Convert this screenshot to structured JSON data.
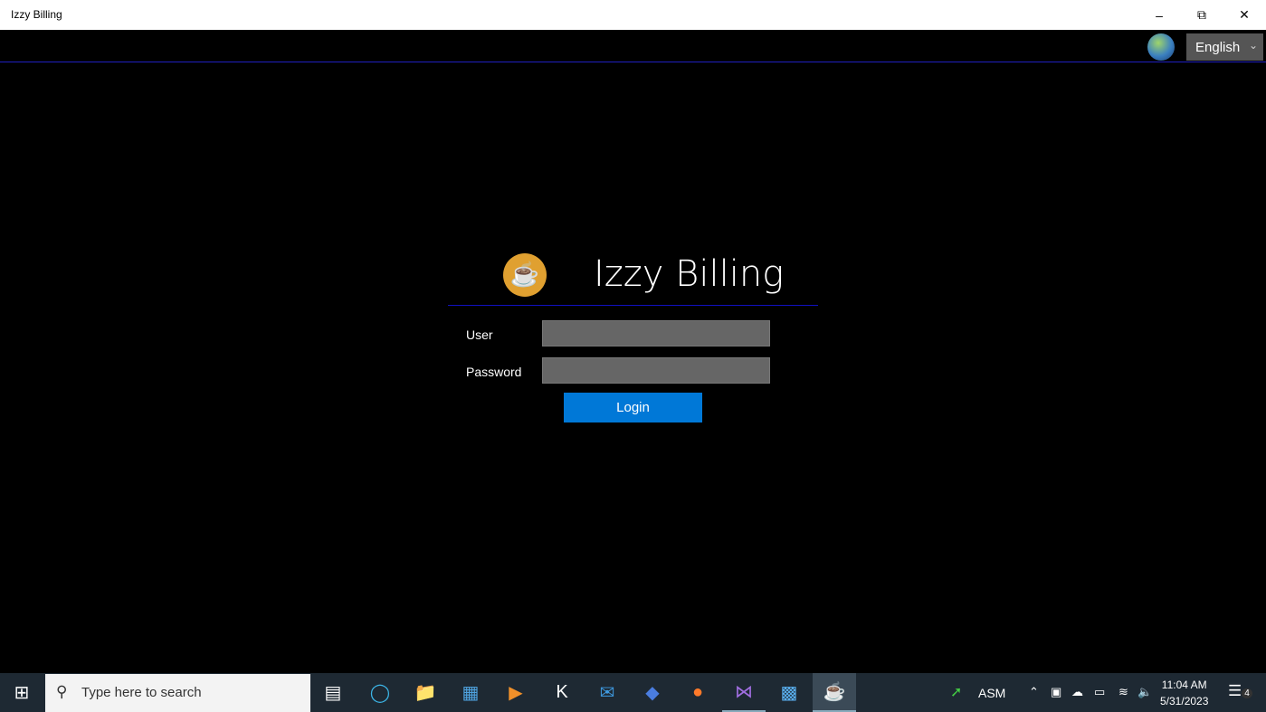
{
  "window": {
    "title": "Izzy Billing"
  },
  "topbar": {
    "language": "English"
  },
  "login": {
    "app_title": "Izzy Billing",
    "user_label": "User",
    "password_label": "Password",
    "user_value": "",
    "password_value": "",
    "login_button": "Login"
  },
  "taskbar": {
    "search_placeholder": "Type here to search",
    "tray_app": "ASM",
    "time": "11:04 AM",
    "date": "5/31/2023",
    "notification_count": "4"
  },
  "colors": {
    "accent": "#0078d7",
    "separator": "#1010c0",
    "logo": "#e0a030"
  }
}
